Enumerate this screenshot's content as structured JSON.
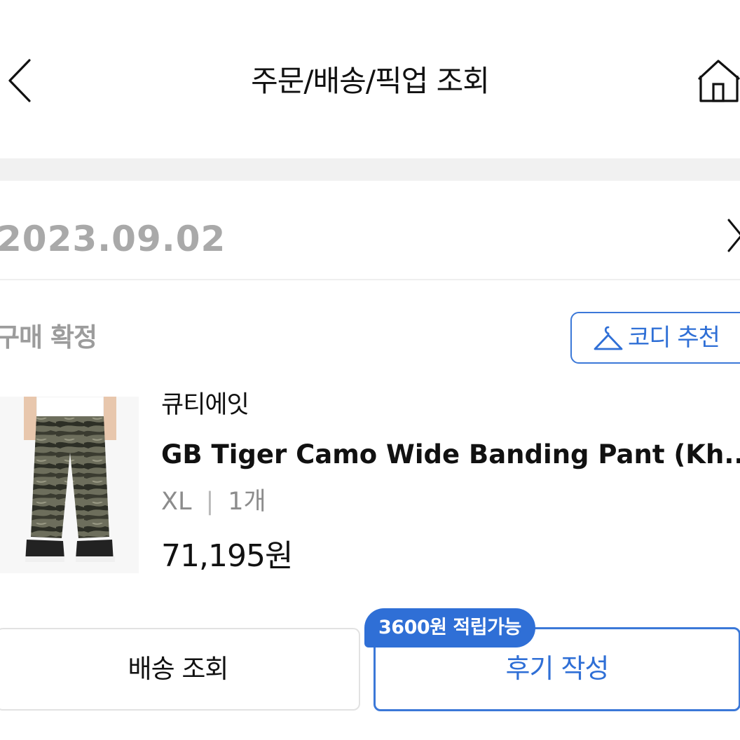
{
  "header": {
    "title": "주문/배송/픽업 조회",
    "back_icon": "chevron-left-icon",
    "home_icon": "home-icon"
  },
  "order": {
    "date": "2023.09.02",
    "detail_icon": "chevron-right-icon",
    "status": "구매 확정",
    "coordi_button": {
      "icon": "hanger-icon",
      "label": "코디 추천"
    }
  },
  "product": {
    "brand": "큐티에잇",
    "name": "GB Tiger Camo Wide Banding Pant (Kh...",
    "size": "XL",
    "separator": "|",
    "quantity": "1개",
    "price": "71,195원"
  },
  "actions": {
    "delivery_label": "배송 조회",
    "review_label": "후기 작성",
    "points_badge": "3600원 적립가능"
  },
  "colors": {
    "accent": "#2f6fd6",
    "muted_text": "#a9a9a9",
    "divider": "#f1f1f1"
  }
}
